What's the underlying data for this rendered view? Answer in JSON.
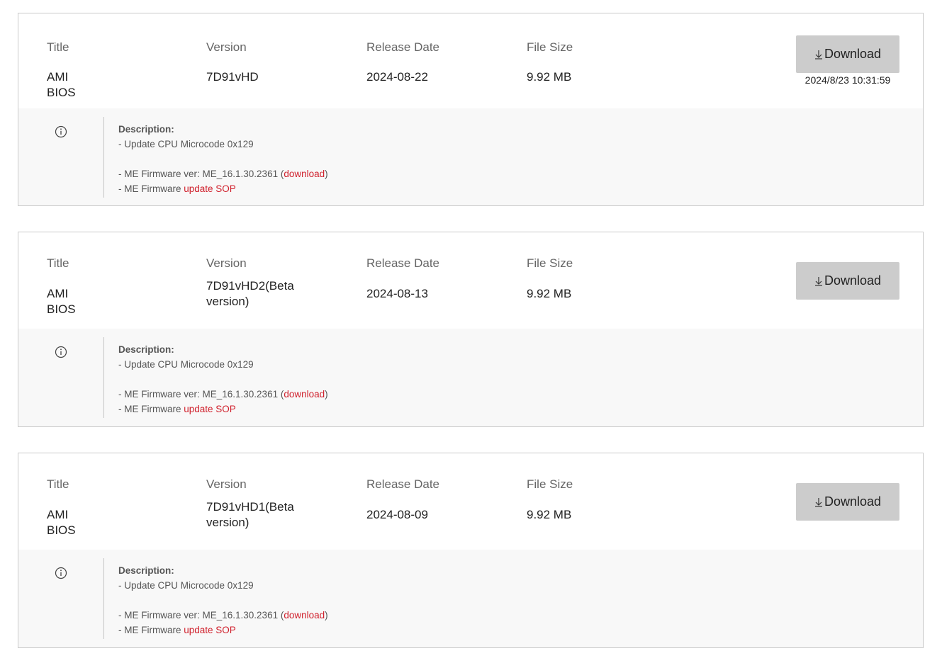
{
  "labels": {
    "title": "Title",
    "version": "Version",
    "release_date": "Release Date",
    "file_size": "File Size",
    "download": "Download",
    "description": "Description:"
  },
  "entries": [
    {
      "title": "AMI BIOS",
      "version": "7D91vHD",
      "release_date": "2024-08-22",
      "file_size": "9.92 MB",
      "download_timestamp": "2024/8/23 10:31:59",
      "desc_line1": "- Update CPU Microcode 0x129",
      "desc_line2_prefix": "- ME Firmware ver: ME_16.1.30.2361 (",
      "desc_line2_link": "download",
      "desc_line2_suffix": ")",
      "desc_line3_prefix": "- ME Firmware ",
      "desc_line3_link": "update SOP"
    },
    {
      "title": "AMI BIOS",
      "version": "7D91vHD2(Beta version)",
      "release_date": "2024-08-13",
      "file_size": "9.92 MB",
      "desc_line1": "- Update CPU Microcode 0x129",
      "desc_line2_prefix": "- ME Firmware ver: ME_16.1.30.2361 (",
      "desc_line2_link": "download",
      "desc_line2_suffix": ")",
      "desc_line3_prefix": "- ME Firmware ",
      "desc_line3_link": "update SOP"
    },
    {
      "title": "AMI BIOS",
      "version": "7D91vHD1(Beta version)",
      "release_date": "2024-08-09",
      "file_size": "9.92 MB",
      "desc_line1": "- Update CPU Microcode 0x129",
      "desc_line2_prefix": "- ME Firmware ver: ME_16.1.30.2361 (",
      "desc_line2_link": "download",
      "desc_line2_suffix": ")",
      "desc_line3_prefix": "- ME Firmware ",
      "desc_line3_link": "update SOP"
    }
  ],
  "icons": {
    "download": "download-arrow-icon",
    "info": "info-circle-icon"
  },
  "colors": {
    "link": "#d0202c",
    "button_bg": "#cccccc",
    "desc_bg": "#f8f8f8",
    "border": "#c9c9c9"
  }
}
